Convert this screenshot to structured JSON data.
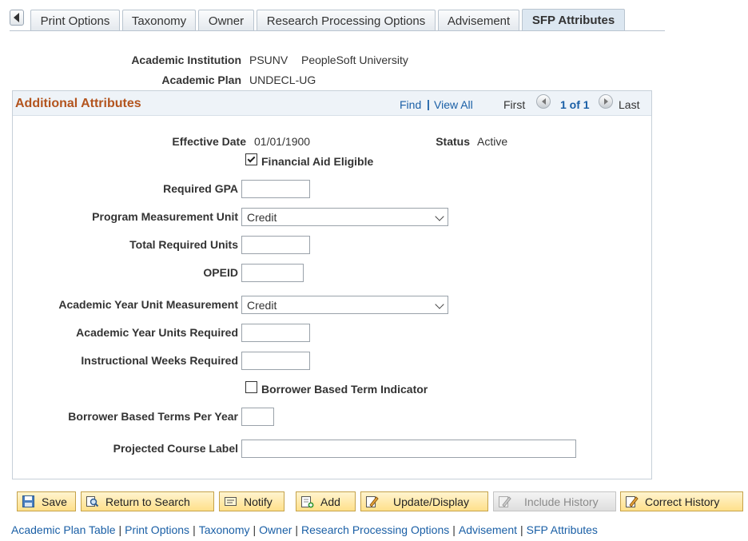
{
  "tabs": [
    "Print Options",
    "Taxonomy",
    "Owner",
    "Research Processing Options",
    "Advisement",
    "SFP Attributes"
  ],
  "header": {
    "institution_label": "Academic Institution",
    "institution_code": "PSUNV",
    "institution_name": "PeopleSoft University",
    "plan_label": "Academic Plan",
    "plan_value": "UNDECL-UG"
  },
  "group": {
    "title": "Additional Attributes",
    "find": "Find",
    "view_all": "View All",
    "first": "First",
    "page_count": "1 of 1",
    "last": "Last"
  },
  "form": {
    "effective_date_label": "Effective Date",
    "effective_date": "01/01/1900",
    "status_label": "Status",
    "status": "Active",
    "financial_aid_label": "Financial Aid Eligible",
    "financial_aid_checked": true,
    "required_gpa_label": "Required GPA",
    "required_gpa": "",
    "program_unit_label": "Program Measurement Unit",
    "program_unit": "Credit",
    "total_units_label": "Total Required Units",
    "total_units": "",
    "opeid_label": "OPEID",
    "opeid": "",
    "ay_unit_label": "Academic Year Unit Measurement",
    "ay_unit": "Credit",
    "ay_units_req_label": "Academic Year Units Required",
    "ay_units_req": "",
    "weeks_label": "Instructional Weeks Required",
    "weeks": "",
    "bbti_label": "Borrower Based Term Indicator",
    "bbti_checked": false,
    "bbtpy_label": "Borrower Based Terms Per Year",
    "bbtpy": "",
    "course_label_label": "Projected Course Label",
    "course_label": ""
  },
  "toolbar": {
    "save": "Save",
    "return": "Return to Search",
    "notify": "Notify",
    "add": "Add",
    "update": "Update/Display",
    "include_history": "Include History",
    "correct_history": "Correct History"
  },
  "footer_links": [
    "Academic Plan Table",
    "Print Options",
    "Taxonomy",
    "Owner",
    "Research Processing Options",
    "Advisement",
    "SFP Attributes"
  ],
  "colors": {
    "link": "#1a5fa6",
    "group_title": "#b3541e",
    "button_fill": "#ffe08a"
  }
}
